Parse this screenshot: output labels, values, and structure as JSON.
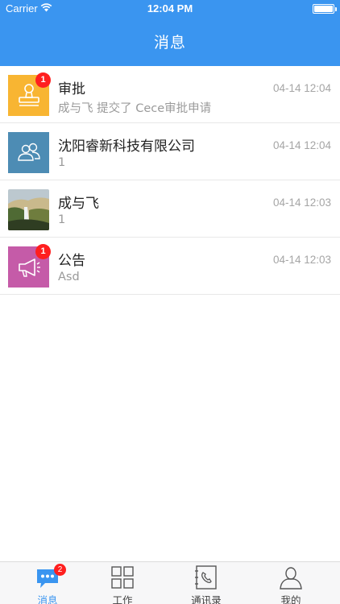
{
  "status_bar": {
    "carrier": "Carrier",
    "time": "12:04 PM"
  },
  "header": {
    "title": "消息"
  },
  "messages": [
    {
      "name": "审批",
      "subtitle": "成与飞 提交了 Cece审批申请",
      "date": "04-14 12:04",
      "badge": "1",
      "icon": "stamp-icon",
      "color": "#f8b532"
    },
    {
      "name": "沈阳睿新科技有限公司",
      "subtitle": "1",
      "date": "04-14 12:04",
      "badge": "",
      "icon": "group-icon",
      "color": "#4d8cb4"
    },
    {
      "name": "成与飞",
      "subtitle": "1",
      "date": "04-14 12:03",
      "badge": "",
      "icon": "landscape-avatar",
      "color": "#6a7a52"
    },
    {
      "name": "公告",
      "subtitle": "Asd",
      "date": "04-14 12:03",
      "badge": "1",
      "icon": "megaphone-icon",
      "color": "#c55ba8"
    }
  ],
  "tabs": [
    {
      "label": "消息",
      "icon": "chat-icon",
      "badge": "2",
      "active": true
    },
    {
      "label": "工作",
      "icon": "grid-icon",
      "badge": "",
      "active": false
    },
    {
      "label": "通讯录",
      "icon": "contacts-icon",
      "badge": "",
      "active": false
    },
    {
      "label": "我的",
      "icon": "profile-icon",
      "badge": "",
      "active": false
    }
  ]
}
